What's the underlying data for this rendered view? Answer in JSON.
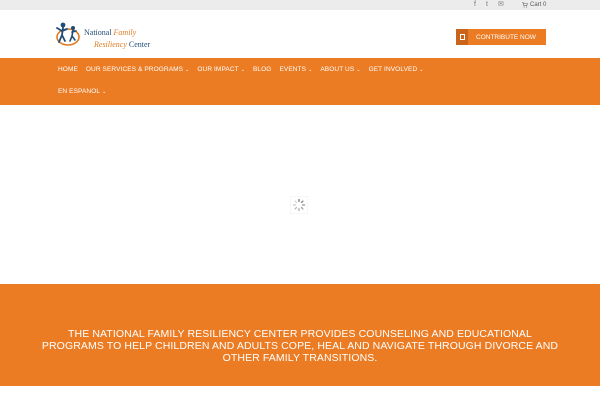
{
  "topbar": {
    "social": [
      {
        "icon": "facebook-icon",
        "glyph": "f"
      },
      {
        "icon": "twitter-icon",
        "glyph": "t"
      },
      {
        "icon": "email-icon",
        "glyph": "✉"
      }
    ],
    "cart_label": "Cart 0"
  },
  "logo": {
    "line1_a": "National",
    "line1_b": "Family",
    "line2_a": "Resiliency",
    "line2_b": "Center"
  },
  "header": {
    "contribute_label": "CONTRIBUTE NOW"
  },
  "nav": {
    "items": [
      {
        "label": "HOME",
        "has_menu": false
      },
      {
        "label": "OUR SERVICES & PROGRAMS",
        "has_menu": true
      },
      {
        "label": "OUR IMPACT",
        "has_menu": true
      },
      {
        "label": "BLOG",
        "has_menu": false
      },
      {
        "label": "EVENTS",
        "has_menu": true
      },
      {
        "label": "ABOUT US",
        "has_menu": true
      },
      {
        "label": "GET INVOLVED",
        "has_menu": true
      },
      {
        "label": "EN ESPANOL",
        "has_menu": true
      }
    ]
  },
  "mission": {
    "text": "The National Family Resiliency Center provides counseling and educational programs to help children and adults cope, heal and navigate through divorce and other family transitions."
  },
  "colors": {
    "brand_orange": "#ec7c24",
    "brand_blue": "#1f4d7a"
  }
}
